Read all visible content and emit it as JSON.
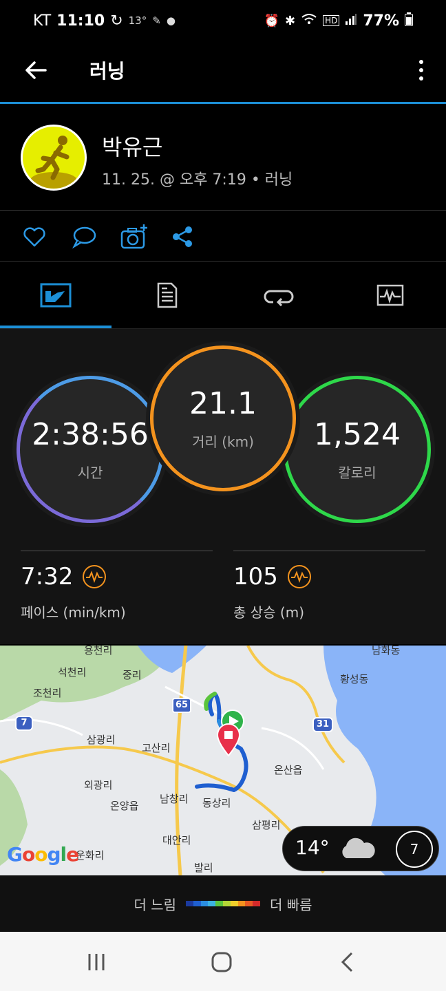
{
  "status_bar": {
    "carrier": "KT",
    "time": "11:10",
    "temperature": "13°",
    "battery": "77%"
  },
  "app_bar": {
    "title": "러닝"
  },
  "profile": {
    "name": "박유근",
    "meta": "11. 25. @ 오후 7:19 • 러닝"
  },
  "stats": {
    "time": {
      "value": "2:38:56",
      "label": "시간"
    },
    "distance": {
      "value": "21.1",
      "label": "거리 (km)"
    },
    "calories": {
      "value": "1,524",
      "label": "칼로리"
    },
    "pace": {
      "value": "7:32",
      "label": "페이스 (min/km)"
    },
    "ascent": {
      "value": "105",
      "label": "총 상승 (m)"
    }
  },
  "map": {
    "labels": [
      "석천리",
      "중리",
      "조천리",
      "삼광리",
      "고산리",
      "외광리",
      "온양읍",
      "남창리",
      "동상리",
      "대안리",
      "삼평리",
      "온산읍",
      "황성동",
      "발리",
      "운화리",
      "남화동",
      "용천리"
    ],
    "road_shields": [
      "65",
      "7",
      "31"
    ],
    "google": "Google",
    "weather_temp": "14°",
    "wind": "7"
  },
  "legend": {
    "slow": "더 느림",
    "fast": "더 빠름",
    "colors": [
      "#1b3a9e",
      "#1f5fd0",
      "#2a8de0",
      "#3cb2e0",
      "#5ac43c",
      "#b4d637",
      "#f0cf2a",
      "#f4931e",
      "#e85a24",
      "#d42a2a"
    ]
  },
  "colors": {
    "accent": "#1c8fd6",
    "time_ring": "#4d9be6",
    "distance_ring": "#f4931e",
    "calories_ring": "#2ed84a"
  }
}
